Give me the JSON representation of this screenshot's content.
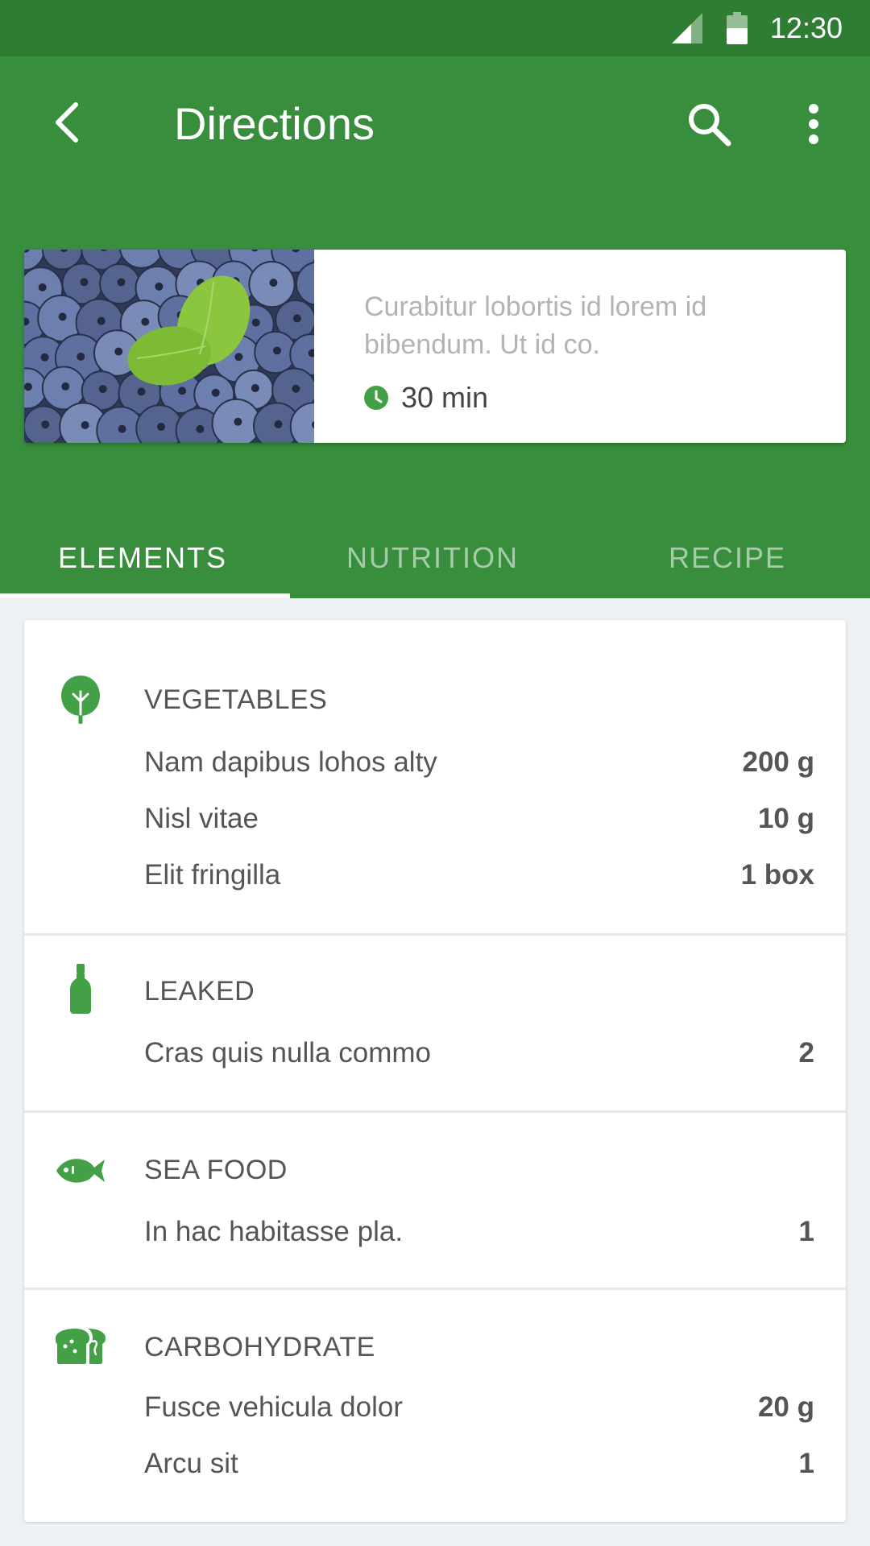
{
  "status_bar": {
    "time": "12:30"
  },
  "header": {
    "title": "Directions"
  },
  "recipe": {
    "description": "Curabitur lobortis id lorem id bibendum. Ut id co.",
    "time": "30 min"
  },
  "tabs": [
    {
      "label": "ELEMENTS",
      "active": true
    },
    {
      "label": "NUTRITION",
      "active": false
    },
    {
      "label": "RECIPE",
      "active": false
    }
  ],
  "sections": [
    {
      "icon": "leaf-icon",
      "title": "VEGETABLES",
      "items": [
        {
          "name": "Nam dapibus lohos alty",
          "qty": "200 g"
        },
        {
          "name": "Nisl vitae",
          "qty": "10 g"
        },
        {
          "name": "Elit fringilla",
          "qty": "1 box"
        }
      ]
    },
    {
      "icon": "bottle-icon",
      "title": "LEAKED",
      "items": [
        {
          "name": "Cras quis nulla commo",
          "qty": "2"
        }
      ]
    },
    {
      "icon": "fish-icon",
      "title": "SEA FOOD",
      "items": [
        {
          "name": "In hac habitasse pla.",
          "qty": "1"
        }
      ]
    },
    {
      "icon": "bread-icon",
      "title": "CARBOHYDRATE",
      "items": [
        {
          "name": "Fusce vehicula dolor",
          "qty": "20 g"
        },
        {
          "name": "Arcu sit",
          "qty": "1"
        }
      ]
    }
  ],
  "colors": {
    "primary": "#388e3c",
    "primary_dark": "#2e7d32",
    "accent_icon": "#43a047"
  }
}
